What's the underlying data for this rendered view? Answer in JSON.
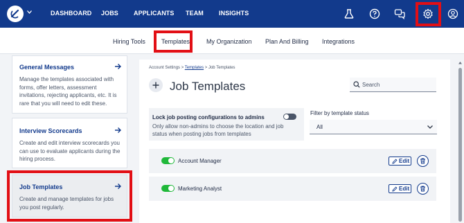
{
  "topnav": {
    "logo_icon": "logo-icon",
    "links": [
      {
        "label": "DASHBOARD"
      },
      {
        "label": "JOBS"
      },
      {
        "label": "APPLICANTS"
      },
      {
        "label": "TEAM"
      },
      {
        "label": "INSIGHTS"
      }
    ],
    "icons": [
      "flask-icon",
      "help-icon",
      "chat-icon",
      "gear-icon",
      "user-icon"
    ],
    "background": "#123a8c"
  },
  "subnav": {
    "tabs": [
      {
        "label": "Hiring Tools"
      },
      {
        "label": "Templates",
        "active": true
      },
      {
        "label": "My Organization"
      },
      {
        "label": "Plan And Billing"
      },
      {
        "label": "Integrations"
      }
    ]
  },
  "sidebar": {
    "cards": [
      {
        "title": "General Messages",
        "description": "Manage the templates associated with forms, offer letters, assessment invitations, rejecting applicants, etc. It is rare that you will need to edit these."
      },
      {
        "title": "Interview Scorecards",
        "description": "Create and edit interview scorecards you can use to evaluate applicants during the hiring process."
      },
      {
        "title": "Job Templates",
        "description": "Create and manage templates for jobs you post regularly.",
        "active": true
      }
    ]
  },
  "main": {
    "breadcrumb": {
      "part1": "Account Settings > ",
      "link": "Templates",
      "part3": " > Job Templates"
    },
    "title": "Job Templates",
    "search": {
      "placeholder": "Search"
    },
    "lock": {
      "title": "Lock job posting configurations to admins",
      "description": "Only allow non-admins to choose the location and job status when posting jobs from templates",
      "enabled": false
    },
    "filter": {
      "label": "Filter by template status",
      "value": "All"
    },
    "templates": [
      {
        "name": "Account Manager",
        "active": true,
        "edit_label": "Edit"
      },
      {
        "name": "Marketing Analyst",
        "active": true,
        "edit_label": "Edit"
      }
    ]
  },
  "colors": {
    "highlight": "#e20f15",
    "accent": "#123a8c",
    "toggle_on": "#20b83a"
  }
}
